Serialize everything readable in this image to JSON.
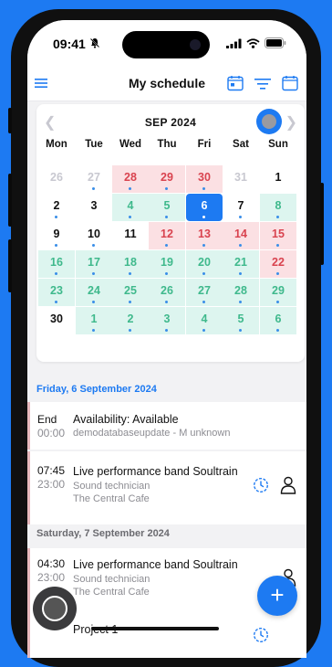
{
  "status_bar": {
    "time": "09:41"
  },
  "header": {
    "title": "My schedule"
  },
  "calendar": {
    "month_label": "SEP 2024",
    "weekdays": [
      "Mon",
      "Tue",
      "Wed",
      "Thu",
      "Fri",
      "Sat",
      "Sun"
    ],
    "weeks": [
      [
        {
          "d": "26",
          "s": "dim"
        },
        {
          "d": "27",
          "s": "dim",
          "dot": true
        },
        {
          "d": "28",
          "s": "red",
          "dot": true
        },
        {
          "d": "29",
          "s": "red",
          "dot": true
        },
        {
          "d": "30",
          "s": "red",
          "dot": true
        },
        {
          "d": "31",
          "s": "dim"
        },
        {
          "d": "1",
          "s": "plain"
        }
      ],
      [
        {
          "d": "2",
          "s": "plain",
          "dot": true
        },
        {
          "d": "3",
          "s": "plain"
        },
        {
          "d": "4",
          "s": "teal",
          "dot": true
        },
        {
          "d": "5",
          "s": "teal",
          "dot": true
        },
        {
          "d": "6",
          "s": "selected",
          "dot": true
        },
        {
          "d": "7",
          "s": "plain",
          "dot": true
        },
        {
          "d": "8",
          "s": "teal",
          "dot": true
        }
      ],
      [
        {
          "d": "9",
          "s": "plain",
          "dot": true
        },
        {
          "d": "10",
          "s": "plain",
          "dot": true
        },
        {
          "d": "11",
          "s": "plain"
        },
        {
          "d": "12",
          "s": "red",
          "dot": true
        },
        {
          "d": "13",
          "s": "red",
          "dot": true
        },
        {
          "d": "14",
          "s": "red",
          "dot": true
        },
        {
          "d": "15",
          "s": "red",
          "dot": true
        }
      ],
      [
        {
          "d": "16",
          "s": "teal",
          "dot": true
        },
        {
          "d": "17",
          "s": "teal",
          "dot": true
        },
        {
          "d": "18",
          "s": "teal",
          "dot": true
        },
        {
          "d": "19",
          "s": "teal",
          "dot": true
        },
        {
          "d": "20",
          "s": "teal",
          "dot": true
        },
        {
          "d": "21",
          "s": "teal",
          "dot": true
        },
        {
          "d": "22",
          "s": "red",
          "dot": true
        }
      ],
      [
        {
          "d": "23",
          "s": "teal",
          "dot": true
        },
        {
          "d": "24",
          "s": "teal",
          "dot": true
        },
        {
          "d": "25",
          "s": "teal",
          "dot": true
        },
        {
          "d": "26",
          "s": "teal",
          "dot": true
        },
        {
          "d": "27",
          "s": "teal",
          "dot": true
        },
        {
          "d": "28",
          "s": "teal",
          "dot": true
        },
        {
          "d": "29",
          "s": "teal",
          "dot": true
        }
      ],
      [
        {
          "d": "30",
          "s": "plain"
        },
        {
          "d": "1",
          "s": "teal",
          "dot": true
        },
        {
          "d": "2",
          "s": "teal",
          "dot": true
        },
        {
          "d": "3",
          "s": "teal",
          "dot": true
        },
        {
          "d": "4",
          "s": "teal",
          "dot": true
        },
        {
          "d": "5",
          "s": "teal",
          "dot": true
        },
        {
          "d": "6",
          "s": "teal",
          "dot": true
        }
      ]
    ]
  },
  "days": [
    {
      "header": "Friday, 6 September 2024",
      "entries": [
        {
          "start": "End",
          "end": "00:00",
          "title": "Availability: Available",
          "subtitle": "demodatabaseupdate - M unknown"
        },
        {
          "start": "07:45",
          "end": "23:00",
          "title": "Live performance band Soultrain",
          "role": "Sound technician",
          "location": "The Central Cafe"
        }
      ]
    },
    {
      "header": "Saturday, 7 September 2024",
      "entries": [
        {
          "start": "04:30",
          "end": "23:00",
          "title": "Live performance band Soultrain",
          "role": "Sound technician",
          "location": "The Central Cafe"
        },
        {
          "title": "Project 1"
        }
      ]
    }
  ],
  "fab": {
    "label": "+"
  },
  "colors": {
    "accent": "#1d7af2",
    "red_bg": "#fbe0e3",
    "teal_bg": "#ddf5ef",
    "red_text": "#d9434f",
    "teal_text": "#3fb98c"
  },
  "icons": [
    "bell-slash-icon",
    "signal-icon",
    "wifi-icon",
    "battery-icon",
    "menu-icon",
    "calendar-icon",
    "filter-icon",
    "month-view-icon",
    "chevron-left-icon",
    "chevron-right-icon",
    "clock-icon",
    "person-icon",
    "plus-icon"
  ]
}
